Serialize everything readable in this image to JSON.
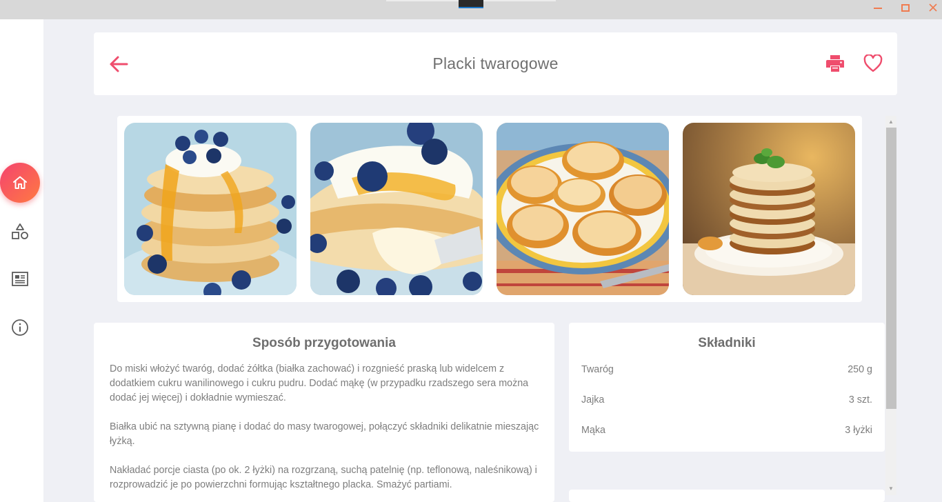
{
  "window": {
    "minimize_icon": "minimize-icon",
    "maximize_icon": "maximize-icon",
    "close_icon": "close-icon",
    "accent_color": "#f07b4f"
  },
  "sidebar": {
    "items": [
      {
        "id": "home",
        "icon": "home-icon",
        "active": true
      },
      {
        "id": "categories",
        "icon": "shapes-icon",
        "active": false
      },
      {
        "id": "articles",
        "icon": "newspaper-icon",
        "active": false
      },
      {
        "id": "info",
        "icon": "info-icon",
        "active": false
      }
    ],
    "active_gradient": [
      "#f4436f",
      "#ff7a42"
    ]
  },
  "header": {
    "title": "Placki twarogowe",
    "back_icon": "arrow-left-icon",
    "print_icon": "printer-icon",
    "favorite_icon": "heart-outline-icon",
    "accent_color": "#ef4d6d"
  },
  "gallery": {
    "photos": [
      {
        "id": "photo-1",
        "subject": "pancake-stack-blueberries-honey"
      },
      {
        "id": "photo-2",
        "subject": "pancakes-fork-blueberries-cream"
      },
      {
        "id": "photo-3",
        "subject": "cheese-fritters-plate"
      },
      {
        "id": "photo-4",
        "subject": "cheese-pancake-stack-mint"
      }
    ]
  },
  "preparation": {
    "heading": "Sposób przygotowania",
    "paragraphs": [
      "Do miski włożyć twaróg, dodać żółtka (białka zachować) i rozgnieść praską lub widelcem z dodatkiem cukru wanilinowego i cukru pudru. Dodać mąkę (w przypadku rzadszego sera można dodać jej więcej) i dokładnie wymieszać.",
      "Białka ubić na sztywną pianę i dodać do masy twarogowej, połączyć składniki delikatnie mieszając łyżką.",
      "Nakładać porcje ciasta (po ok. 2 łyżki) na rozgrzaną, suchą patelnię (np. teflonową, naleśnikową) i rozprowadzić je po powierzchni formując kształtnego placka. Smażyć partiami."
    ]
  },
  "ingredients": {
    "heading": "Składniki",
    "items": [
      {
        "name": "Twaróg",
        "amount": "250 g"
      },
      {
        "name": "Jajka",
        "amount": "3 szt."
      },
      {
        "name": "Mąka",
        "amount": "3 łyżki"
      }
    ]
  }
}
